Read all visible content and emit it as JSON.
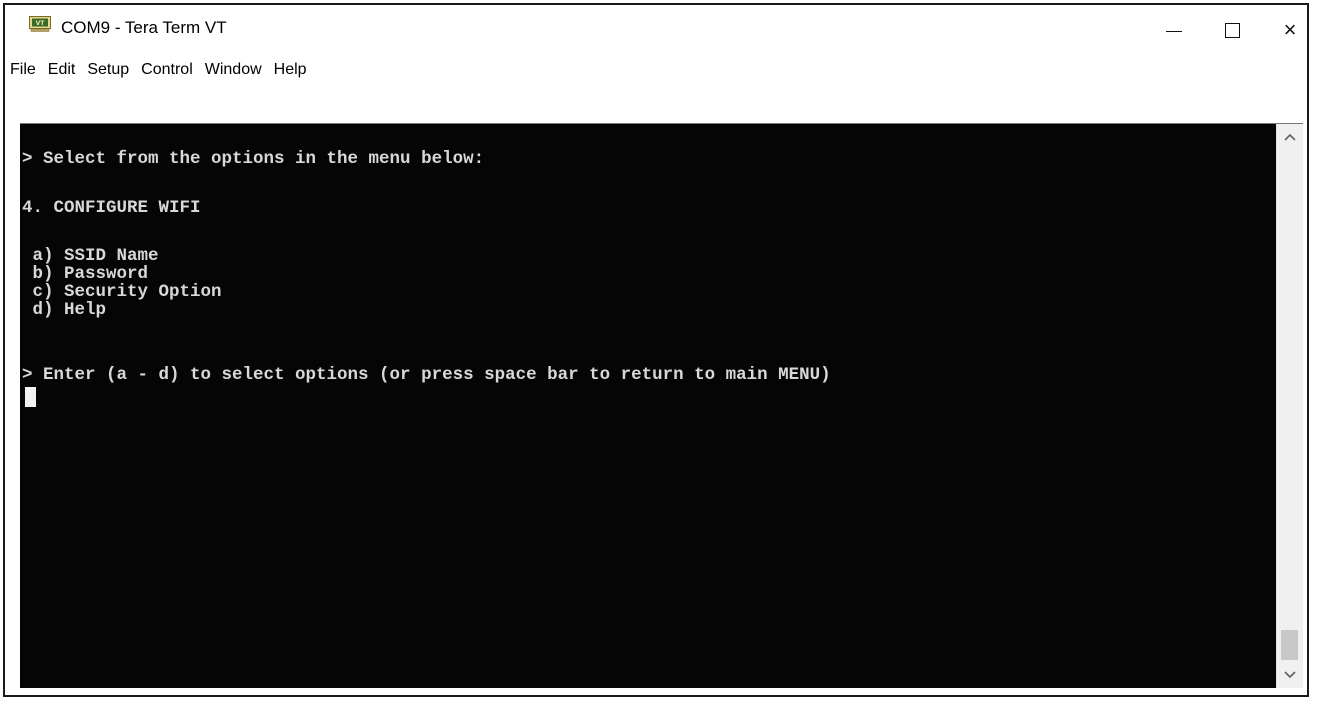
{
  "window": {
    "title": "COM9 - Tera Term VT",
    "icon": "teraterm-vt-icon",
    "controls": {
      "minimize": "minimize-icon",
      "maximize": "maximize-icon",
      "close": "×"
    }
  },
  "menu": [
    "File",
    "Edit",
    "Setup",
    "Control",
    "Window",
    "Help"
  ],
  "terminal": {
    "lines": [
      "> Select from the options in the menu below:",
      "4. CONFIGURE WIFI",
      " a) SSID Name",
      " b) Password",
      " c) Security Option",
      " d) Help",
      "> Enter (a - d) to select options (or press space bar to return to main MENU)"
    ],
    "colors": {
      "background": "#050505",
      "text": "#d8d8d8",
      "cursor": "#f2f2f2"
    }
  },
  "scrollbar": {
    "up": "▲",
    "down": "▼"
  }
}
